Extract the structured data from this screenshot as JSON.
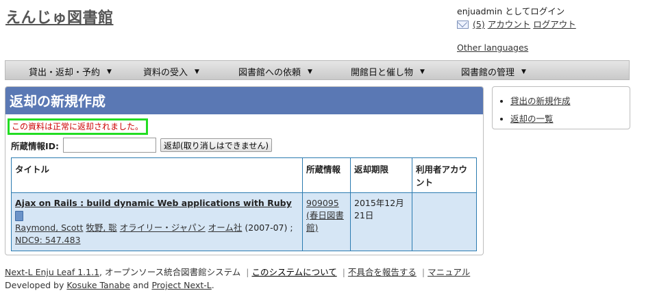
{
  "header": {
    "site_title": "えんじゅ図書館",
    "login_text": "enjuadmin としてログイン",
    "message_count": "(5)",
    "account_link": "アカウント",
    "logout_link": "ログアウト",
    "other_languages": "Other languages"
  },
  "nav": {
    "items": [
      {
        "label": "貸出・返却・予約"
      },
      {
        "label": "資料の受入"
      },
      {
        "label": "図書館への依頼"
      },
      {
        "label": "開館日と催し物"
      },
      {
        "label": "図書館の管理"
      }
    ]
  },
  "main": {
    "heading": "返却の新規作成",
    "notice": "この資料は正常に返却されました。",
    "item_id_label": "所蔵情報ID:",
    "item_id_value": "",
    "return_button": "返却(取り消しはできません)",
    "table": {
      "headers": [
        "タイトル",
        "所蔵情報",
        "返却期限",
        "利用者アカウント"
      ],
      "row": {
        "title": "Ajax on Rails : build dynamic Web applications with Ruby",
        "creators": [
          "Raymond, Scott",
          "牧野, 聡",
          "オライリー・ジャパン",
          "オーム社"
        ],
        "date_suffix": "(2007-07) ;",
        "ndc": "NDC9: 547.483",
        "item_identifier": "909095",
        "item_library": "(春日図書館)",
        "due_date": "2015年12月21日",
        "user_account": ""
      }
    }
  },
  "sidebar": {
    "items": [
      {
        "label": "貸出の新規作成"
      },
      {
        "label": "返却の一覧"
      }
    ]
  },
  "footer": {
    "product": "Next-L Enju Leaf 1.1.1",
    "description": ", オープンソース統合図書館システム",
    "about": "このシステムについて",
    "report": "不具合を報告する",
    "manual": "マニュアル",
    "developed_by": "Developed by",
    "author": "Kosuke Tanabe",
    "and": "and",
    "project": "Project Next-L",
    "period": "."
  },
  "colors": {
    "heading_bg": "#5a78b4",
    "notice_border": "#22dd22",
    "notice_text": "#cc0000",
    "table_row_bg": "#d6e6f5"
  }
}
